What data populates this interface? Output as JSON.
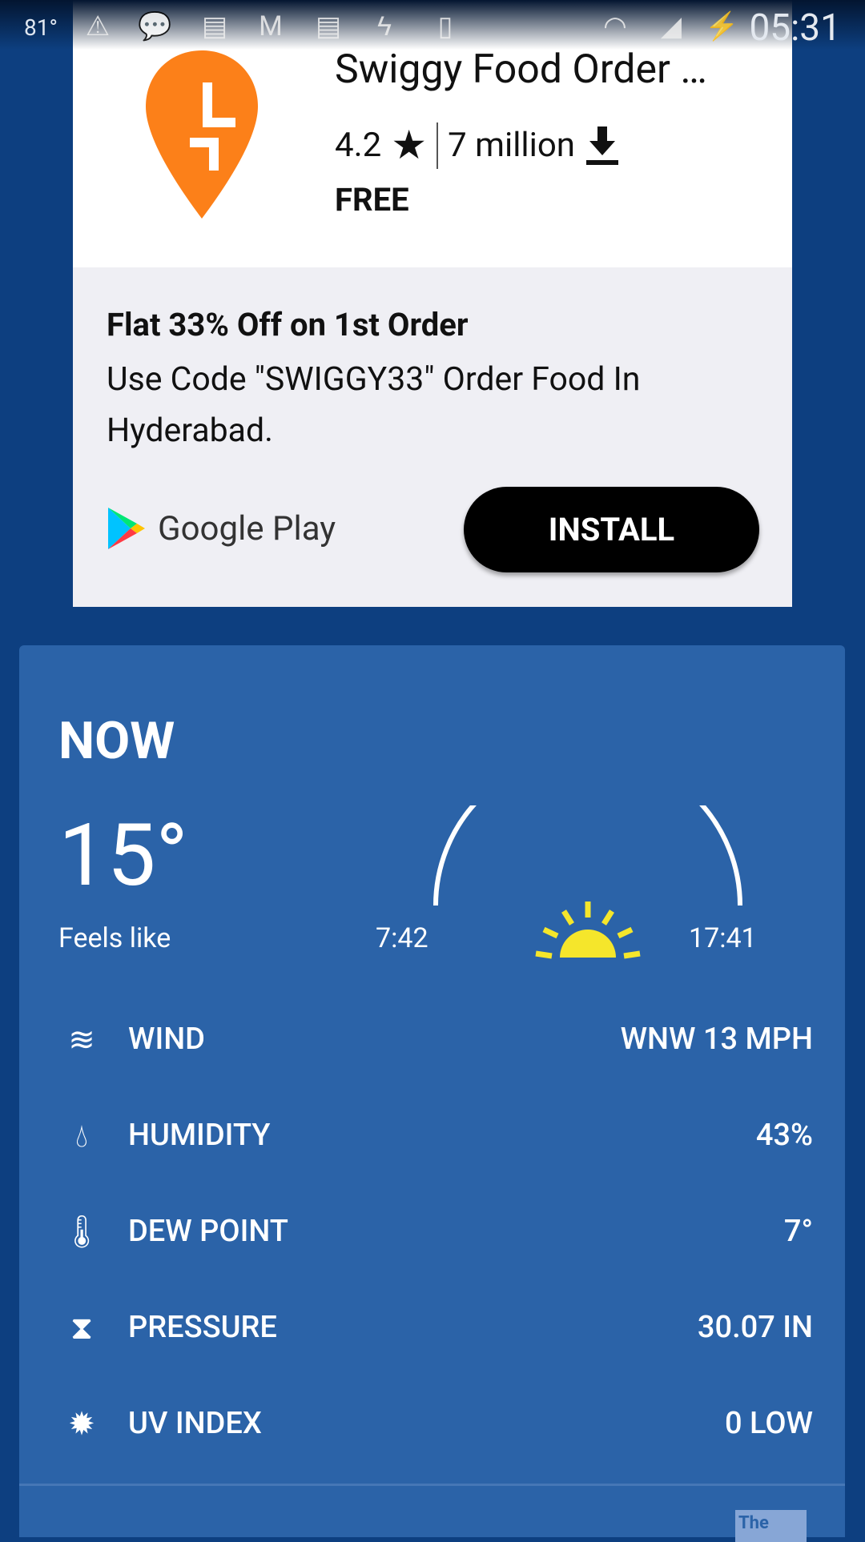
{
  "status_bar": {
    "temperature": "81°",
    "time": "05:31",
    "icons": [
      "warning-icon",
      "chat-icon",
      "news-icon",
      "gmail-icon",
      "news-icon",
      "flash-icon",
      "phone-clock-icon",
      "wifi-icon",
      "signal-icon",
      "battery-charging-icon"
    ]
  },
  "ad": {
    "app_name": "Swiggy Food Order …",
    "rating": "4.2",
    "downloads": "7 million",
    "price": "FREE",
    "headline": "Flat 33% Off on 1st Order",
    "description": "Use Code \"SWIGGY33\" Order Food In Hyderabad.",
    "store": "Google Play",
    "install_label": "INSTALL",
    "brand_color": "#fc8019"
  },
  "weather": {
    "title": "NOW",
    "temperature": "15°",
    "feels_like_label": "Feels like",
    "sunrise": "7:42",
    "sunset": "17:41",
    "rows": [
      {
        "icon": "wind-icon",
        "label": "WIND",
        "value": "WNW 13 MPH"
      },
      {
        "icon": "humidity-icon",
        "label": "HUMIDITY",
        "value": "43%"
      },
      {
        "icon": "dew-point-icon",
        "label": "DEW POINT",
        "value": "7°"
      },
      {
        "icon": "pressure-icon",
        "label": "PRESSURE",
        "value": "30.07 IN"
      },
      {
        "icon": "uv-index-icon",
        "label": "UV INDEX",
        "value": "0 LOW"
      }
    ],
    "logo_text": "The"
  }
}
